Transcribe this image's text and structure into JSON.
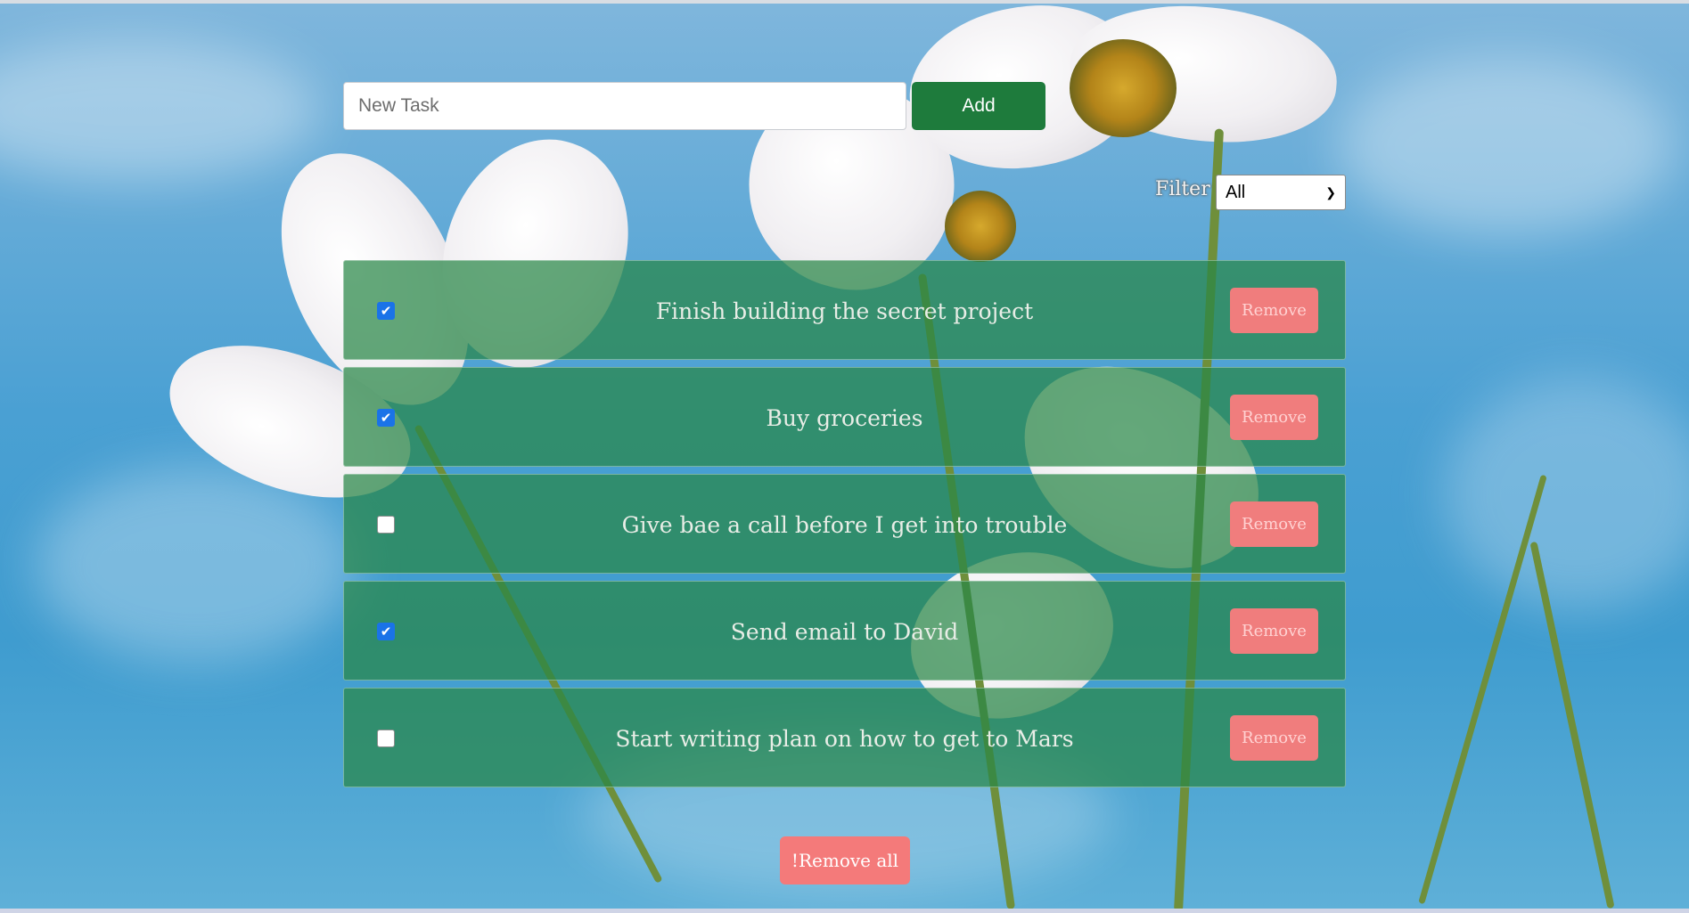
{
  "task_input": {
    "placeholder": "New Task",
    "value": ""
  },
  "add_button": {
    "label": "Add"
  },
  "filter": {
    "label": "Filter",
    "selected": "All"
  },
  "tasks": [
    {
      "text": "Finish building the secret project",
      "done": true,
      "remove_label": "Remove"
    },
    {
      "text": "Buy groceries",
      "done": true,
      "remove_label": "Remove"
    },
    {
      "text": "Give bae a call before I get into trouble",
      "done": false,
      "remove_label": "Remove"
    },
    {
      "text": "Send email to David",
      "done": true,
      "remove_label": "Remove"
    },
    {
      "text": "Start writing plan on how to get to Mars",
      "done": false,
      "remove_label": "Remove"
    }
  ],
  "remove_all_button": {
    "label": "!Remove all"
  },
  "colors": {
    "add_button": "#1e7b3c",
    "task_row": "#288746",
    "remove_button": "#f07d7d",
    "checkbox_checked": "#1a73e8"
  }
}
